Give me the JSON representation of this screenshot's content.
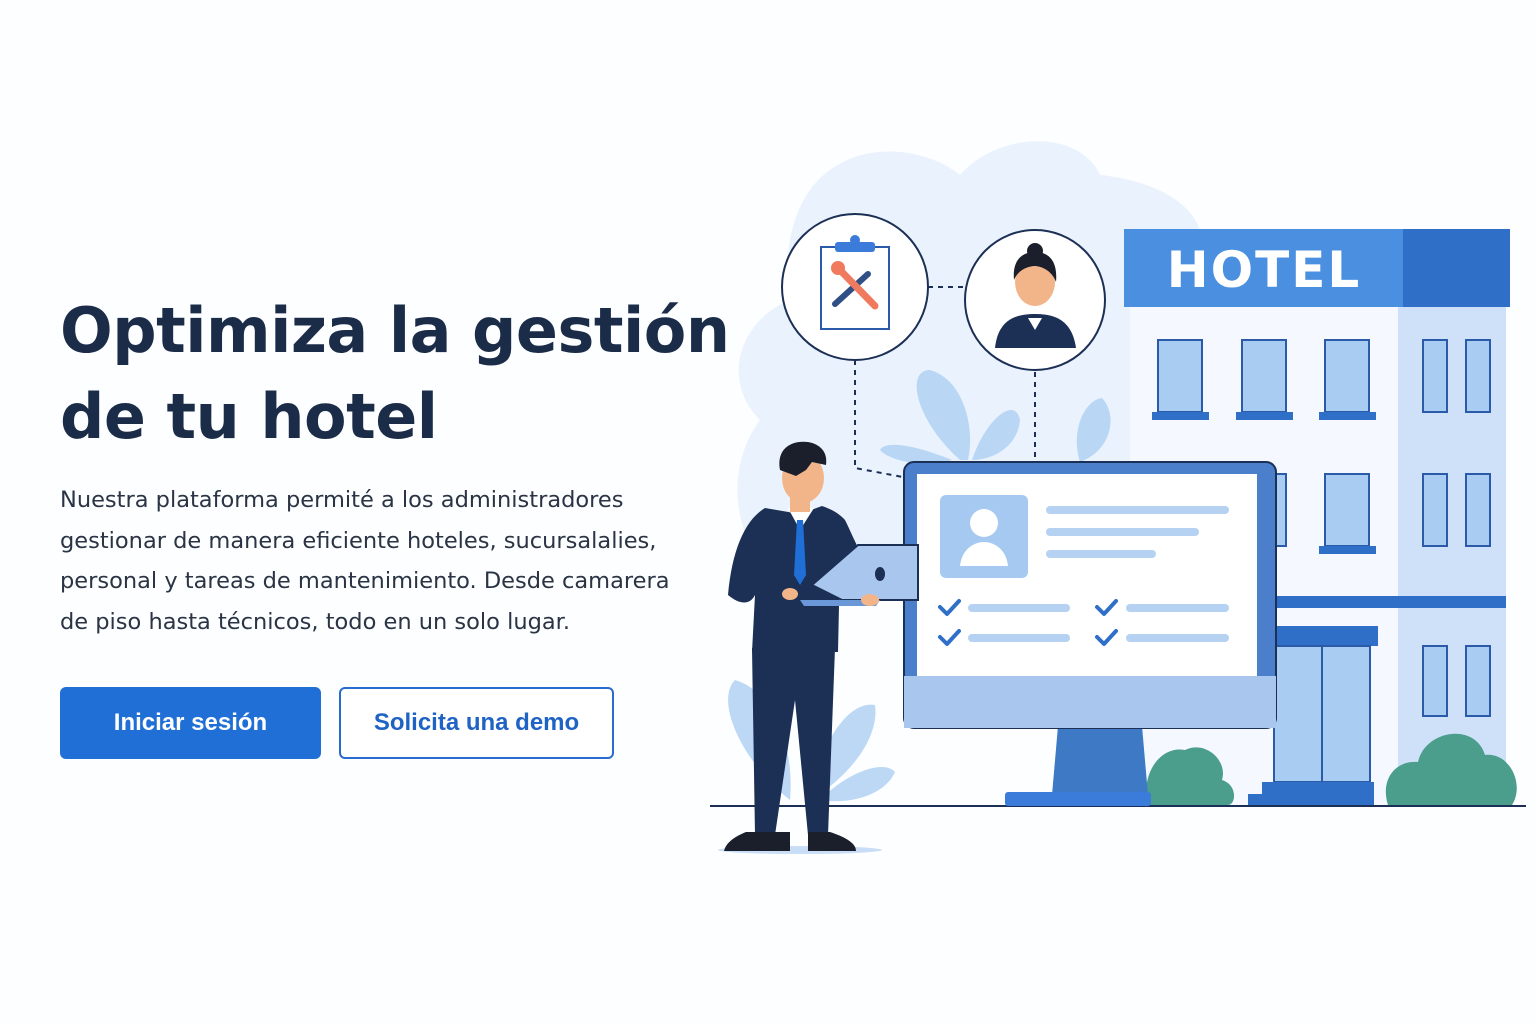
{
  "hero": {
    "title_lines": [
      "Optimiza la gestión",
      "de tu hotel"
    ],
    "description_lines": [
      "Nuestra plataforma permité a los administradores",
      "gestionar de manera eficiente hoteles, sucursalalies,",
      "personal y tareas de mantenimiento. Desde camarera",
      "de piso hasta técnicos, todo en un solo lugar."
    ]
  },
  "actions": {
    "login_label": "Iniciar sesión",
    "demo_label": "Solicita una demo"
  },
  "illustration": {
    "hotel_sign": "HOTEL",
    "icons": [
      "maintenance-clipboard-icon",
      "housekeeper-avatar-icon",
      "manager-figure",
      "monitor-dashboard",
      "laptop",
      "plant",
      "bush"
    ]
  },
  "colors": {
    "primary": "#1f6fd6",
    "heading": "#1b2c48",
    "navy": "#1c2f55",
    "sign_blue": "#4b8fe0",
    "accent_green": "#4a9e8b"
  }
}
